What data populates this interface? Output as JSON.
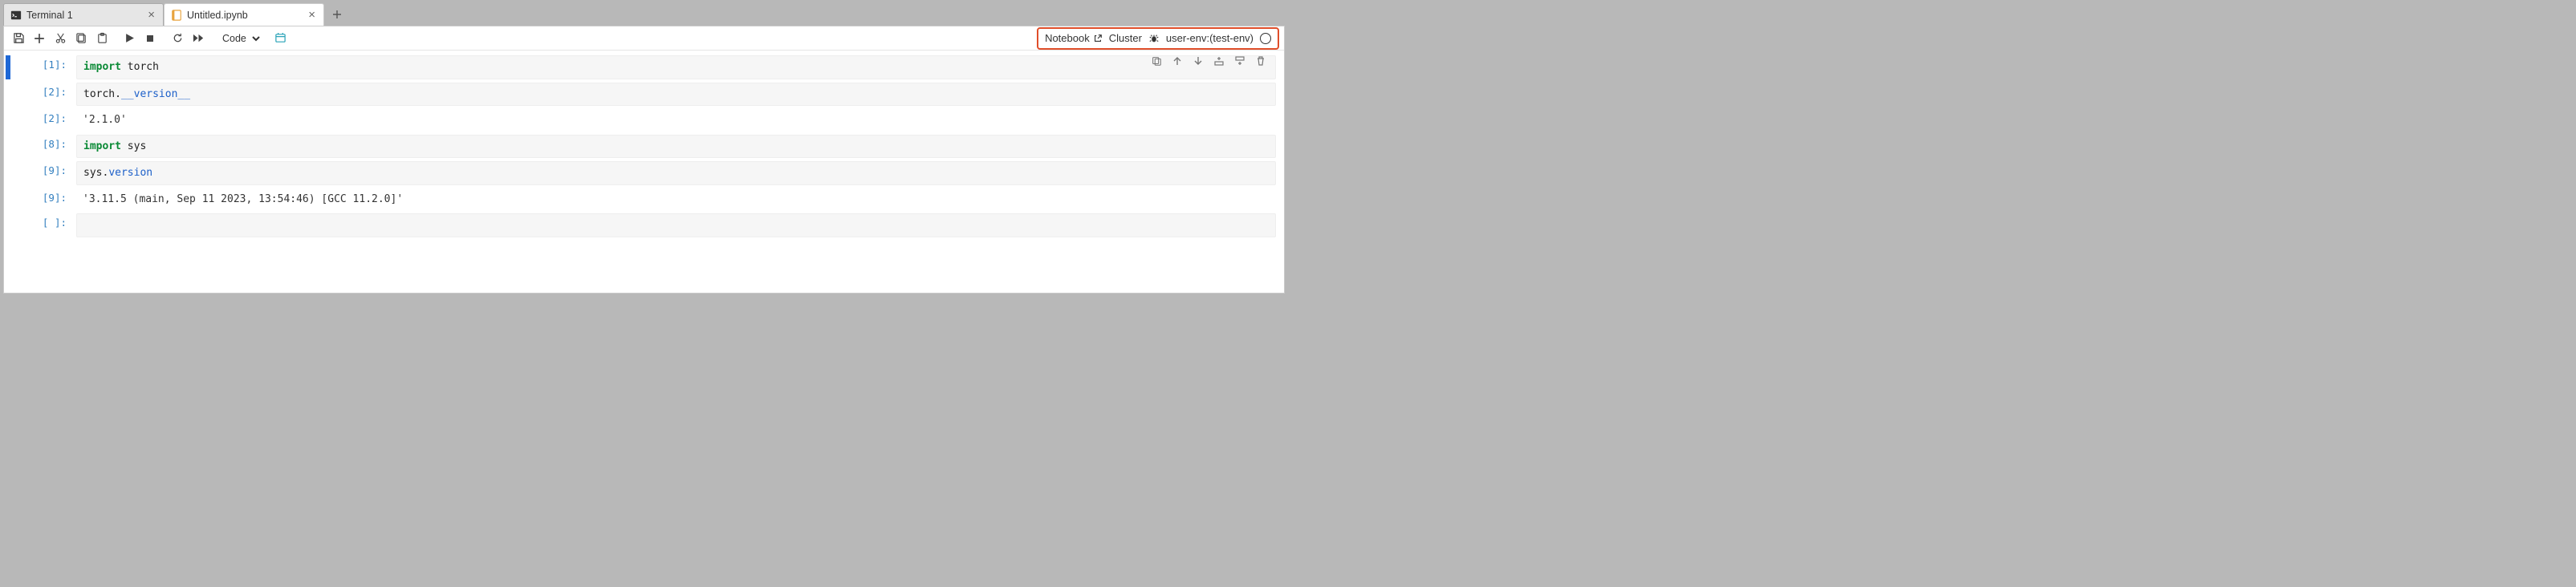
{
  "tabs": [
    {
      "label": "Terminal 1",
      "icon": "terminal-icon",
      "active": false
    },
    {
      "label": "Untitled.ipynb",
      "icon": "notebook-icon",
      "active": true
    }
  ],
  "toolbar": {
    "cell_type_value": "Code",
    "right": {
      "notebook_label": "Notebook",
      "cluster_label": "Cluster",
      "kernel_label": "user-env:(test-env)"
    }
  },
  "cell_actions": {
    "duplicate_title": "Duplicate",
    "move_up_title": "Move up",
    "move_down_title": "Move down",
    "insert_above_title": "Insert above",
    "insert_below_title": "Insert below",
    "delete_title": "Delete"
  },
  "cells": [
    {
      "type": "code",
      "exec_count": "1",
      "selected": true,
      "source_tokens": [
        {
          "t": "import",
          "c": "kw"
        },
        {
          "t": " torch",
          "c": "name"
        }
      ]
    },
    {
      "type": "code",
      "exec_count": "2",
      "source_tokens": [
        {
          "t": "torch.",
          "c": "name"
        },
        {
          "t": "__version__",
          "c": "dunder"
        }
      ],
      "output": "'2.1.0'"
    },
    {
      "type": "code",
      "exec_count": "8",
      "source_tokens": [
        {
          "t": "import",
          "c": "kw"
        },
        {
          "t": " sys",
          "c": "name"
        }
      ]
    },
    {
      "type": "code",
      "exec_count": "9",
      "source_tokens": [
        {
          "t": "sys.",
          "c": "name"
        },
        {
          "t": "version",
          "c": "attr"
        }
      ],
      "output": "'3.11.5 (main, Sep 11 2023, 13:54:46) [GCC 11.2.0]'"
    },
    {
      "type": "code",
      "exec_count": "",
      "source_tokens": []
    }
  ]
}
